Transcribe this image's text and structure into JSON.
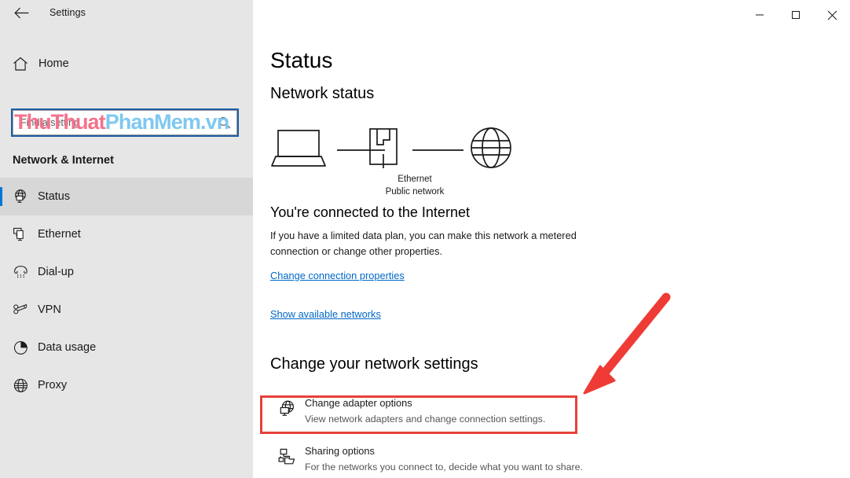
{
  "window": {
    "title": "Settings",
    "back_icon": "back-arrow-icon",
    "controls": [
      {
        "name": "minimize-button",
        "glyph": "minimize-icon"
      },
      {
        "name": "maximize-button",
        "glyph": "maximize-icon"
      },
      {
        "name": "close-button",
        "glyph": "close-icon"
      }
    ]
  },
  "sidebar": {
    "home_label": "Home",
    "home_icon": "home-icon",
    "search": {
      "placeholder": "Find a setting",
      "value": "",
      "icon": "search-icon"
    },
    "category": "Network & Internet",
    "items": [
      {
        "label": "Status",
        "icon": "globe-monitor-icon",
        "selected": true
      },
      {
        "label": "Ethernet",
        "icon": "ethernet-monitor-icon",
        "selected": false
      },
      {
        "label": "Dial-up",
        "icon": "dialup-phone-icon",
        "selected": false
      },
      {
        "label": "VPN",
        "icon": "vpn-key-icon",
        "selected": false
      },
      {
        "label": "Data usage",
        "icon": "pie-chart-icon",
        "selected": false
      },
      {
        "label": "Proxy",
        "icon": "globe-icon",
        "selected": false
      }
    ]
  },
  "main": {
    "page_title": "Status",
    "network_status_heading": "Network status",
    "diagram": {
      "device_icon": "laptop-icon",
      "adapter_icon": "ethernet-port-icon",
      "internet_icon": "globe-icon",
      "caption_line1": "Ethernet",
      "caption_line2": "Public network"
    },
    "connected_heading": "You're connected to the Internet",
    "connected_description": "If you have a limited data plan, you can make this network a metered connection or change other properties.",
    "links": [
      {
        "label": "Change connection properties"
      },
      {
        "label": "Show available networks"
      }
    ],
    "change_settings_heading": "Change your network settings",
    "options": [
      {
        "title": "Change adapter options",
        "subtitle": "View network adapters and change connection settings.",
        "icon": "globe-monitor-icon",
        "highlighted": true
      },
      {
        "title": "Sharing options",
        "subtitle": "For the networks you connect to, decide what you want to share.",
        "icon": "share-folder-icon",
        "highlighted": false
      }
    ]
  },
  "annotations": {
    "highlight_box_color": "#e8403a",
    "arrow_color": "#ef3b36",
    "arrow_name": "red-pointer-arrow",
    "watermark": {
      "part1": "ThuThuat",
      "part2": "PhanMem.vn",
      "color1": "#f4728c",
      "color2": "#7ec8f0"
    }
  },
  "colors": {
    "sidebar_bg": "#e6e6e6",
    "main_bg": "#ffffff",
    "accent": "#0078d7",
    "link": "#0068c8",
    "selected_row_bg": "#d7d7d7"
  }
}
